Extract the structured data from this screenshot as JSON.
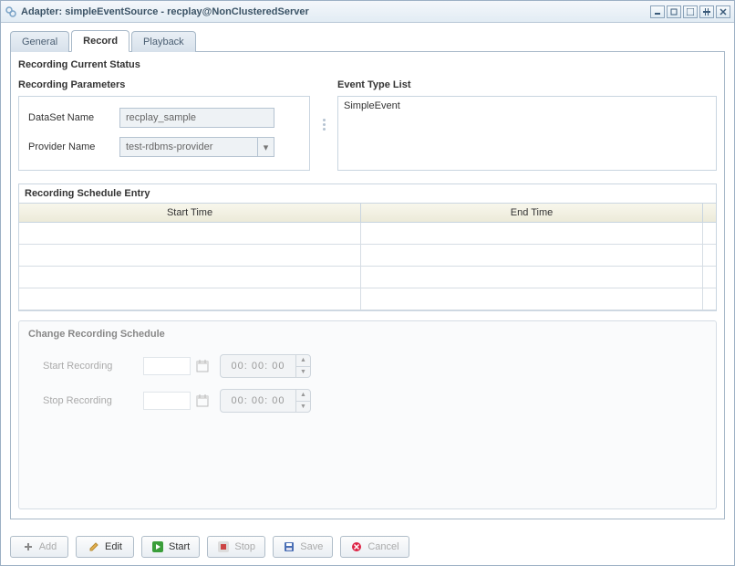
{
  "window": {
    "title": "Adapter: simpleEventSource - recplay@NonClusteredServer"
  },
  "tabs": {
    "general": "General",
    "record": "Record",
    "playback": "Playback",
    "active": "record"
  },
  "status": {
    "heading": "Recording Current Status"
  },
  "params": {
    "heading": "Recording Parameters",
    "dataset_label": "DataSet Name",
    "dataset_value": "recplay_sample",
    "provider_label": "Provider Name",
    "provider_value": "test-rdbms-provider"
  },
  "eventlist": {
    "heading": "Event Type List",
    "items": [
      "SimpleEvent"
    ]
  },
  "schedule": {
    "heading": "Recording Schedule Entry",
    "col_start": "Start Time",
    "col_end": "End Time",
    "rows": [
      {
        "start": "",
        "end": ""
      },
      {
        "start": "",
        "end": ""
      },
      {
        "start": "",
        "end": ""
      },
      {
        "start": "",
        "end": ""
      }
    ]
  },
  "change": {
    "heading": "Change Recording Schedule",
    "start_label": "Start Recording",
    "stop_label": "Stop Recording",
    "start_date": "",
    "start_time": "00: 00: 00",
    "stop_date": "",
    "stop_time": "00: 00: 00"
  },
  "buttons": {
    "add": "Add",
    "edit": "Edit",
    "start": "Start",
    "stop": "Stop",
    "save": "Save",
    "cancel": "Cancel"
  }
}
